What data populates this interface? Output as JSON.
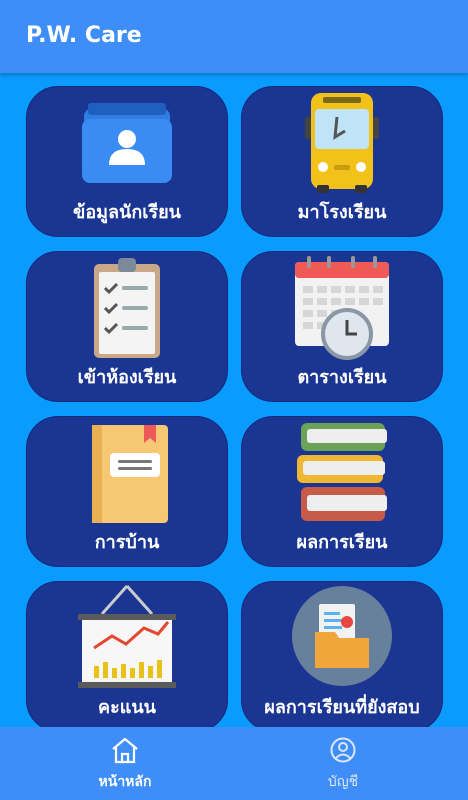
{
  "app": {
    "title": "P.W. Care"
  },
  "menu": {
    "items": [
      {
        "label": "ข้อมูลนักเรียน",
        "icon": "student-folder-icon"
      },
      {
        "label": "มาโรงเรียน",
        "icon": "school-bus-icon"
      },
      {
        "label": "เข้าห้องเรียน",
        "icon": "clipboard-checklist-icon"
      },
      {
        "label": "ตารางเรียน",
        "icon": "calendar-clock-icon"
      },
      {
        "label": "การบ้าน",
        "icon": "notebook-icon"
      },
      {
        "label": "ผลการเรียน",
        "icon": "book-stack-icon"
      },
      {
        "label": "คะแนน",
        "icon": "chart-board-icon"
      },
      {
        "label": "ผลการเรียนที่ยังสอบ",
        "icon": "folder-report-icon"
      }
    ]
  },
  "bottom_nav": {
    "items": [
      {
        "label": "หน้าหลัก",
        "icon": "home-icon",
        "active": true
      },
      {
        "label": "บัญชี",
        "icon": "account-icon",
        "active": false
      }
    ]
  },
  "colors": {
    "background": "#0a9bff",
    "appbar": "#3f8ef7",
    "tile": "#1a3592"
  }
}
